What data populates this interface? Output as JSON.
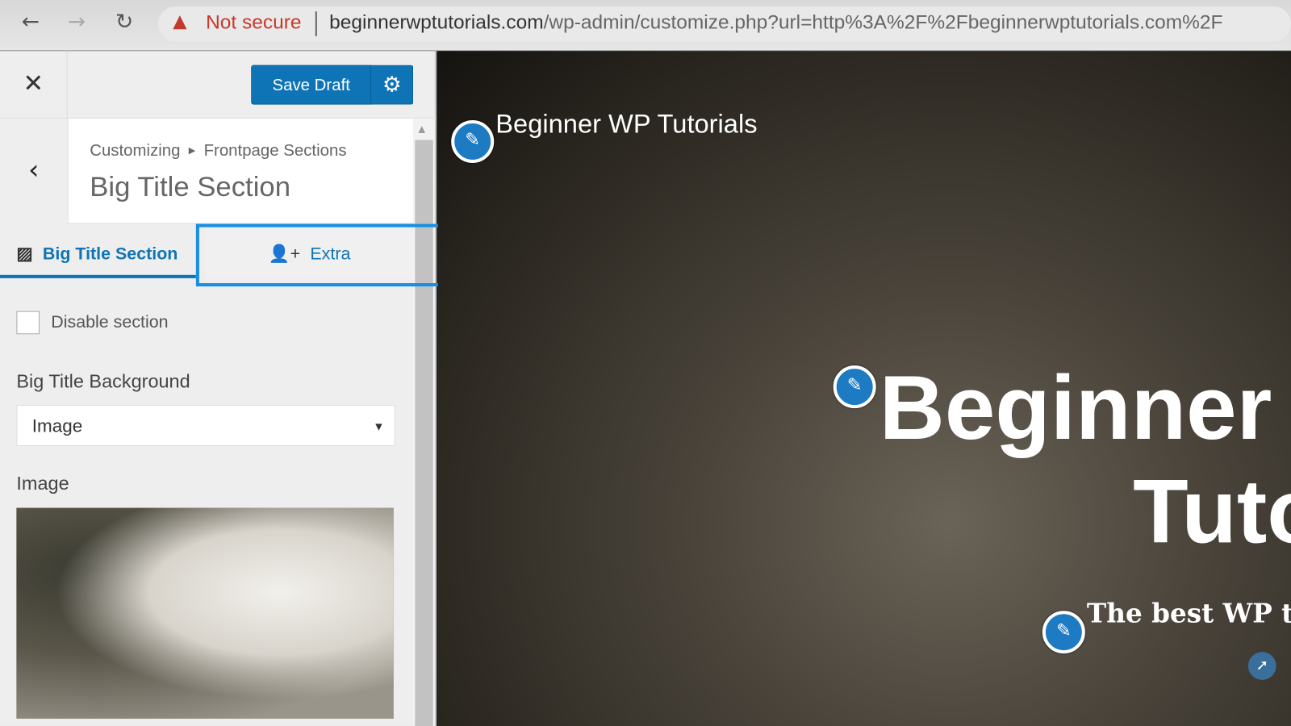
{
  "browser": {
    "security_label": "Not secure",
    "url_host": "beginnerwptutorials.com",
    "url_path": "/wp-admin/customize.php?url=http%3A%2F%2Fbeginnerwptutorials.com%2F"
  },
  "panel": {
    "save_label": "Save Draft",
    "breadcrumb": [
      "Customizing",
      "Frontpage Sections"
    ],
    "section_title": "Big Title Section",
    "tabs": [
      {
        "label": "Big Title Section",
        "icon": "image-icon",
        "active": true
      },
      {
        "label": "Extra",
        "icon": "user-plus-icon",
        "active": false
      }
    ],
    "disable_label": "Disable section",
    "disable_checked": false,
    "background_label": "Big Title Background",
    "background_value": "Image",
    "image_label": "Image"
  },
  "preview": {
    "site_name": "Beginner WP Tutorials",
    "hero_line1": "Beginner",
    "hero_line2": "Tuto",
    "tagline": "The best WP tuto"
  },
  "colors": {
    "accent": "#0f74b5",
    "highlight": "#1a8fe0",
    "warning": "#c5392a"
  }
}
